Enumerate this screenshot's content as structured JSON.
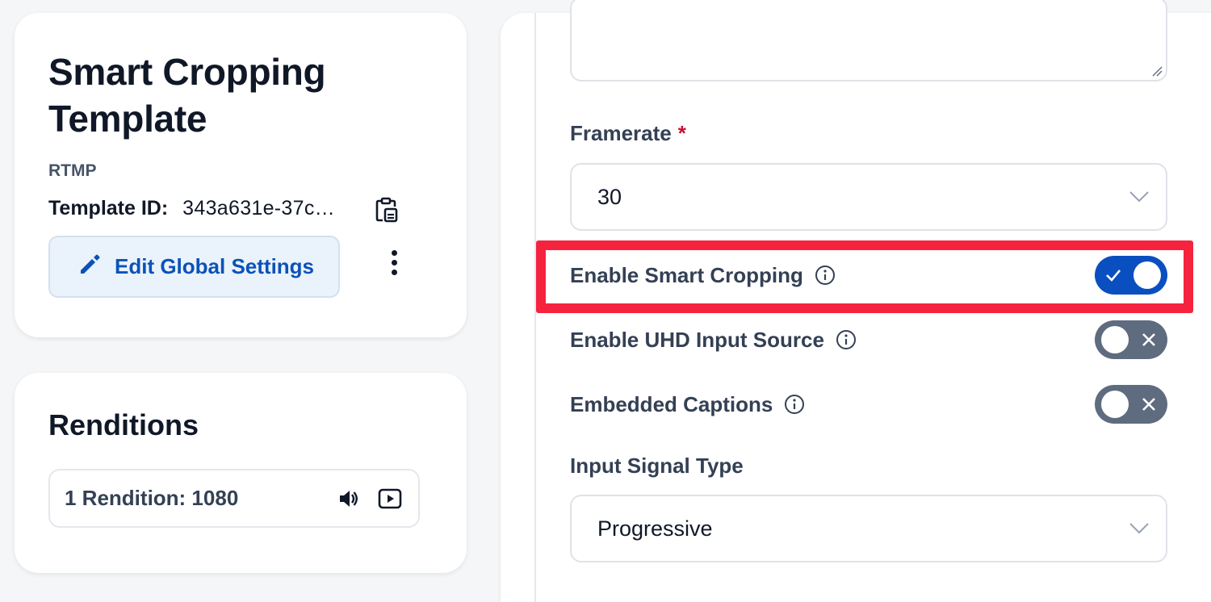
{
  "template": {
    "title": "Smart Cropping Template",
    "protocol": "RTMP",
    "template_id_label": "Template ID:",
    "template_id_value": "343a631e-37c…",
    "edit_button_label": "Edit Global Settings"
  },
  "renditions": {
    "title": "Renditions",
    "summary": "1 Rendition: 1080"
  },
  "form": {
    "framerate": {
      "label": "Framerate",
      "required_marker": "*",
      "value": "30"
    },
    "toggles": [
      {
        "label": "Enable Smart Cropping",
        "state": "on"
      },
      {
        "label": "Enable UHD Input Source",
        "state": "off"
      },
      {
        "label": "Embedded Captions",
        "state": "off"
      }
    ],
    "input_signal_type": {
      "label": "Input Signal Type",
      "value": "Progressive"
    }
  },
  "colors": {
    "accent": "#0a4fc0",
    "toggle_off": "#5f6b7f",
    "highlight": "#f6233f",
    "required": "#c8102e"
  },
  "icons": [
    "copy-icon",
    "pencil-icon",
    "more-vertical-icon",
    "volume-icon",
    "video-icon",
    "info-icon",
    "chevron-down-icon",
    "check-icon",
    "x-icon"
  ]
}
